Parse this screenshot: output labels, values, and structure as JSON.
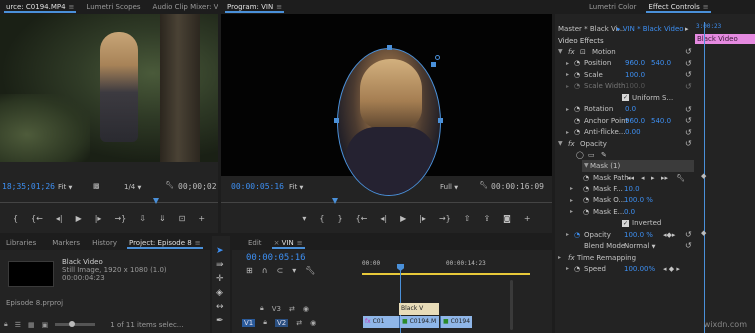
{
  "source": {
    "tabs": [
      {
        "label": "urce: C0194.MP4",
        "active": true
      },
      {
        "label": "Lumetri Scopes"
      },
      {
        "label": "Audio Clip Mixer: V"
      }
    ],
    "timecode": "18;35;01;26",
    "fit": "Fit",
    "ratio": "1/4",
    "duration": "00;00;02"
  },
  "program": {
    "tab": "Program: VIN",
    "timecode": "00:00:05:16",
    "fit": "Fit",
    "quality": "Full",
    "duration": "00:00:16:09"
  },
  "effect_controls": {
    "tabs": [
      {
        "label": "Lumetri Color"
      },
      {
        "label": "Effect Controls",
        "active": true
      }
    ],
    "master": "Master * Black Vi...",
    "clip": "VIN * Black Video",
    "header_time": "3:00:23",
    "clip_bar": "Black Video",
    "section": "Video Effects",
    "motion": "Motion",
    "position": {
      "label": "Position",
      "x": "960.0",
      "y": "540.0"
    },
    "scale": {
      "label": "Scale",
      "value": "100.0"
    },
    "scale_width": {
      "label": "Scale Width",
      "value": "100.0"
    },
    "uniform_scale": "Uniform S...",
    "rotation": {
      "label": "Rotation",
      "value": "0.0"
    },
    "anchor": {
      "label": "Anchor Point",
      "x": "960.0",
      "y": "540.0"
    },
    "antiflicker": {
      "label": "Anti-flicke...",
      "value": "0.00"
    },
    "opacity_fx": "Opacity",
    "mask": "Mask (1)",
    "mask_path": "Mask Path",
    "mask_feather": {
      "label": "Mask F...",
      "value": "10.0"
    },
    "mask_opacity": {
      "label": "Mask O...",
      "value": "100.0 %"
    },
    "mask_expansion": {
      "label": "Mask E...",
      "value": "0.0"
    },
    "inverted": "Inverted",
    "opacity": {
      "label": "Opacity",
      "value": "100.0 %"
    },
    "blend_mode": {
      "label": "Blend Mode",
      "value": "Normal"
    },
    "time_remap": "Time Remapping",
    "speed": {
      "label": "Speed",
      "value": "100.00%"
    }
  },
  "project": {
    "tabs": [
      {
        "label": "Libraries"
      },
      {
        "label": "Markers"
      },
      {
        "label": "History"
      },
      {
        "label": "Project: Episode 8",
        "active": true
      }
    ],
    "clip_name": "Black Video",
    "clip_info": "Still Image, 1920 x 1080 (1.0)",
    "clip_duration": "00:00:04:23",
    "file": "Episode 8.prproj",
    "selection": "1 of 11 items selec..."
  },
  "timeline": {
    "tabs": [
      {
        "label": "Edit"
      },
      {
        "label": "VIN",
        "active": true
      }
    ],
    "timecode": "00:00:05:16",
    "ruler": [
      "00:00",
      "00:00:14:23"
    ],
    "tracks": [
      "V3",
      "V2"
    ],
    "track_source": "V1",
    "clips": {
      "black": "Black V",
      "c1": "C01",
      "c2": "C0194.M",
      "c3": "C0194"
    }
  },
  "watermark": "wixdn.com",
  "colors": {
    "accent": "#3d8ff2",
    "clip_pink": "#e58ae0",
    "clip_blue": "#8fb6e8",
    "playhead": "#4a90d9"
  }
}
